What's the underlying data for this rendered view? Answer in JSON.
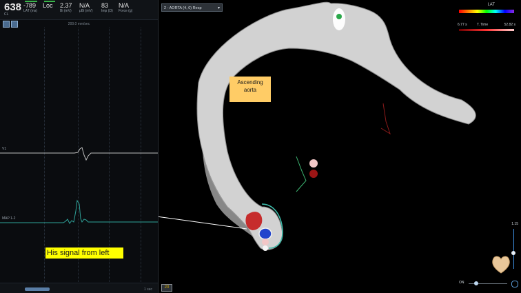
{
  "left_panel": {
    "metrics": [
      {
        "value": "638",
        "label": "CL"
      },
      {
        "value": "-789",
        "label": "LAT (ms)"
      },
      {
        "value": "Loc",
        "label": ""
      },
      {
        "value": "2.37",
        "label": "Bi (mV)"
      },
      {
        "value": "N/A",
        "label": "μBi (mV)"
      },
      {
        "value": "83",
        "label": "Imp (Ω)"
      },
      {
        "value": "N/A",
        "label": "Force (g)"
      }
    ],
    "scale_text": "200.0 mm/sec",
    "channel1_label": "V1",
    "channel2_label": "MAP 1-2",
    "bottom_text": "1 sec",
    "his_annotation": "His signal from left",
    "colors": {
      "ecg_trace": "#bfbfbf",
      "his_trace": "#2fa39a"
    }
  },
  "right_panel": {
    "map_selector": "2 - AORTA (4, 0) Resp",
    "legend": {
      "title": "LAT",
      "min": "6.77 s",
      "mid": "T. Time",
      "max": "52.82 s"
    },
    "aorta_annotation": "Ascending\naorta",
    "slider_value": "1.15",
    "zoom_label": "ON",
    "button_20": "20",
    "icons": {
      "heart_orientation": "heart-icon",
      "zoom": "zoom-slider"
    },
    "colors": {
      "surface": "#cfcfcf",
      "highlight": "#3bb7a6",
      "catheter_blue": "#2244cc",
      "tag_red": "#c41a1a"
    }
  }
}
